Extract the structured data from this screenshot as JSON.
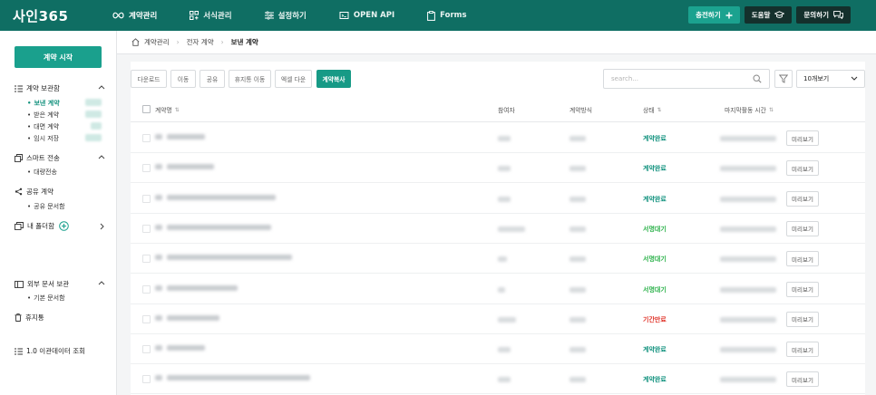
{
  "app": {
    "logo": "사인365"
  },
  "nav": [
    {
      "label": "계약관리",
      "icon": "infinity-icon",
      "active": true
    },
    {
      "label": "서식관리",
      "icon": "grid-icon",
      "active": false
    },
    {
      "label": "설정하기",
      "icon": "sliders-icon",
      "active": false
    },
    {
      "label": "OPEN API",
      "icon": "api-icon",
      "active": false
    },
    {
      "label": "Forms",
      "icon": "clipboard-icon",
      "active": false
    }
  ],
  "top_actions": {
    "charge": "충전하기",
    "help": "도움말",
    "inquiry": "문의하기"
  },
  "sidebar": {
    "start_button": "계약 시작",
    "contract_storage": {
      "title": "계약 보관함",
      "items": [
        {
          "label": "보낸 계약",
          "active": true
        },
        {
          "label": "받은 계약",
          "active": false
        },
        {
          "label": "대면 계약",
          "active": false
        },
        {
          "label": "임시 저장",
          "active": false
        }
      ]
    },
    "smart_send": {
      "title": "스마트 전송",
      "items": [
        {
          "label": "대량전송"
        }
      ]
    },
    "shared": {
      "title": "공유 계약",
      "items": [
        {
          "label": "공유 문서함"
        }
      ]
    },
    "my_folder": {
      "title": "내 폴더함"
    },
    "external": {
      "title": "외부 문서 보관",
      "items": [
        {
          "label": "기본 문서함"
        }
      ]
    },
    "trash": {
      "title": "휴지통"
    },
    "migration": {
      "title": "1.0 이관데이터 조회"
    }
  },
  "breadcrumb": {
    "home": "계약관리",
    "mid": "전자 계약",
    "current": "보낸 계약"
  },
  "toolbar": {
    "buttons": [
      "다운로드",
      "이동",
      "공유",
      "휴지통 이동",
      "엑셀 다운",
      "계약복사"
    ],
    "search_placeholder": "search...",
    "page_size": "10개보기"
  },
  "table": {
    "headers": {
      "name": "계약명",
      "participant": "참여자",
      "method": "계약방식",
      "status": "상태",
      "last_activity": "마지막활동 시간"
    },
    "preview_label": "미리보기",
    "rows": [
      {
        "status": "계약완료"
      },
      {
        "status": "계약완료"
      },
      {
        "status": "계약완료"
      },
      {
        "status": "서명대기"
      },
      {
        "status": "서명대기"
      },
      {
        "status": "서명대기"
      },
      {
        "status": "기간만료"
      },
      {
        "status": "계약완료"
      },
      {
        "status": "계약완료"
      }
    ]
  },
  "colors": {
    "brand": "#0f6e63",
    "accent": "#1aa08d",
    "status_complete": "#13937f",
    "status_waiting": "#2bb14a",
    "status_expired": "#e0352b"
  }
}
